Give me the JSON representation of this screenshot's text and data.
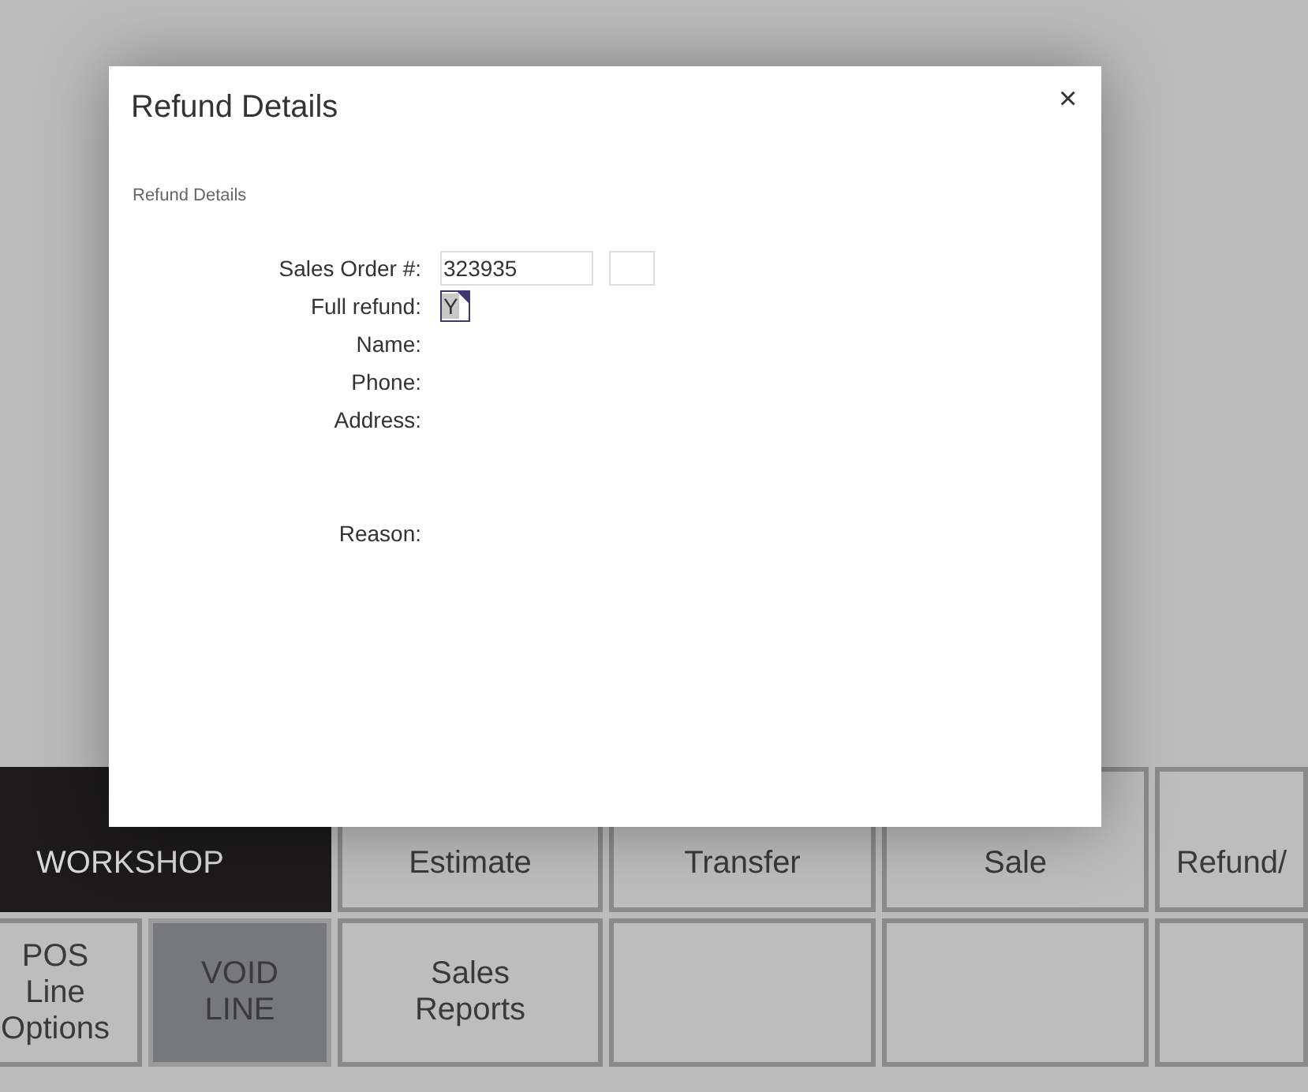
{
  "buttons_row_1": [
    {
      "lines": [
        "WORKSHOP"
      ],
      "kind": "dark"
    },
    {
      "lines": [
        "Estimate"
      ],
      "kind": "normal"
    },
    {
      "lines": [
        "Transfer"
      ],
      "kind": "normal"
    },
    {
      "lines": [
        "Sale"
      ],
      "kind": "normal"
    },
    {
      "lines": [
        "Refund/"
      ],
      "kind": "normal"
    }
  ],
  "buttons_row_2": [
    {
      "lines": [
        "POS",
        "Line",
        "Options"
      ],
      "kind": "normal"
    },
    {
      "lines": [
        "VOID",
        "LINE"
      ],
      "kind": "muted"
    },
    {
      "lines": [
        "Sales",
        "Reports"
      ],
      "kind": "normal"
    },
    {
      "kind": "normal"
    },
    {
      "kind": "normal"
    },
    {
      "kind": "normal"
    }
  ],
  "dialog": {
    "title": "Refund Details",
    "close": "×",
    "section": "Refund Details",
    "fields": [
      {
        "label": "Sales Order #:",
        "kind": "text",
        "value": "323935",
        "extra_box": true
      },
      {
        "label": "Full refund:",
        "kind": "flag",
        "value": "Y",
        "focused": true
      },
      {
        "label": "Name:",
        "kind": "empty"
      },
      {
        "label": "Phone:",
        "kind": "empty"
      },
      {
        "label": "Address:",
        "kind": "multiline"
      },
      {
        "label": "Reason:",
        "kind": "empty"
      }
    ]
  }
}
